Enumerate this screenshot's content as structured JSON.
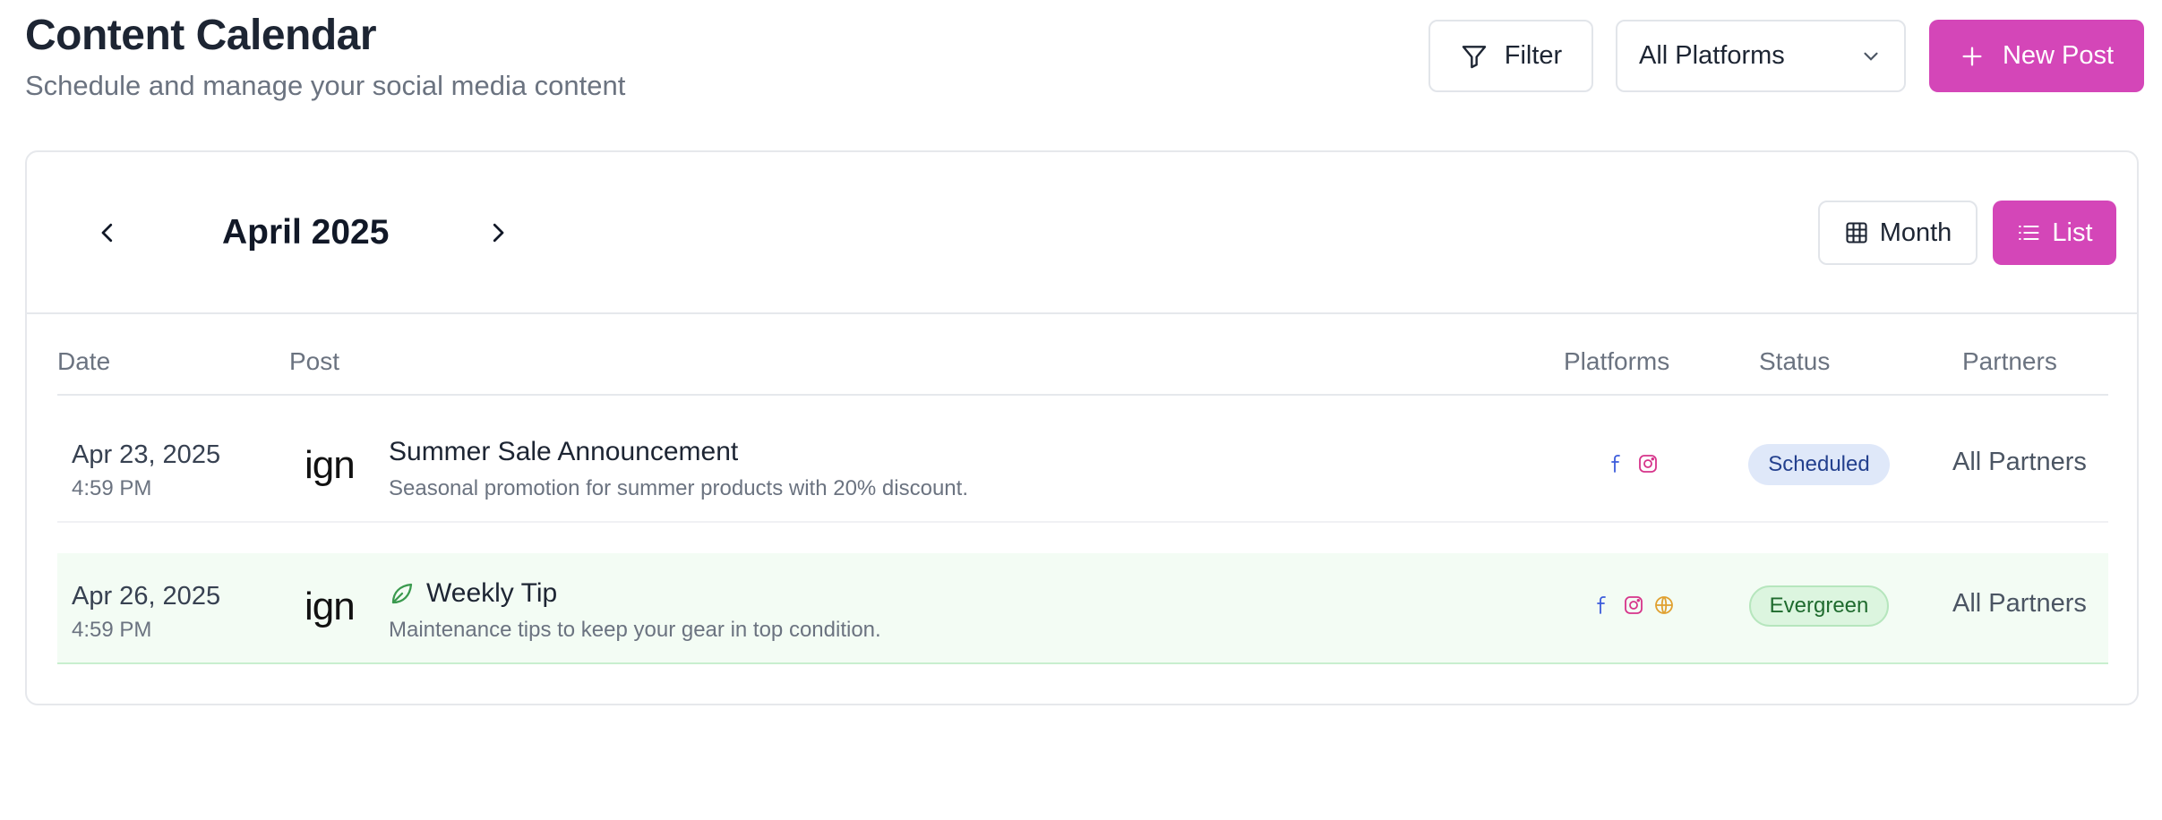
{
  "header": {
    "title": "Content Calendar",
    "subtitle": "Schedule and manage your social media content",
    "filter_label": "Filter",
    "platform_select": "All Platforms",
    "new_post_label": "New Post"
  },
  "calendar": {
    "month_label": "April 2025",
    "view_month_label": "Month",
    "view_list_label": "List"
  },
  "table": {
    "columns": [
      "Date",
      "Post",
      "Platforms",
      "Status",
      "Partners"
    ],
    "rows": [
      {
        "date": "Apr 23, 2025",
        "time": "4:59 PM",
        "logo": "ign",
        "title": "Summer Sale Announcement",
        "description": "Seasonal promotion for summer products with 20% discount.",
        "platforms": [
          "facebook-icon",
          "instagram-icon"
        ],
        "status": "Scheduled",
        "partners": "All Partners"
      },
      {
        "date": "Apr 26, 2025",
        "time": "4:59 PM",
        "logo": "ign",
        "title": "Weekly Tip",
        "description": "Maintenance tips to keep your gear in top condition.",
        "platforms": [
          "facebook-icon",
          "instagram-icon",
          "globe-icon"
        ],
        "status": "Evergreen",
        "partners": "All Partners"
      }
    ]
  },
  "colors": {
    "accent": "#d446b8",
    "scheduled_bg": "#dfe8f9",
    "evergreen_bg": "#dcf5df",
    "facebook": "#3b5bdb",
    "instagram": "#d6338a",
    "globe": "#e0a030"
  }
}
